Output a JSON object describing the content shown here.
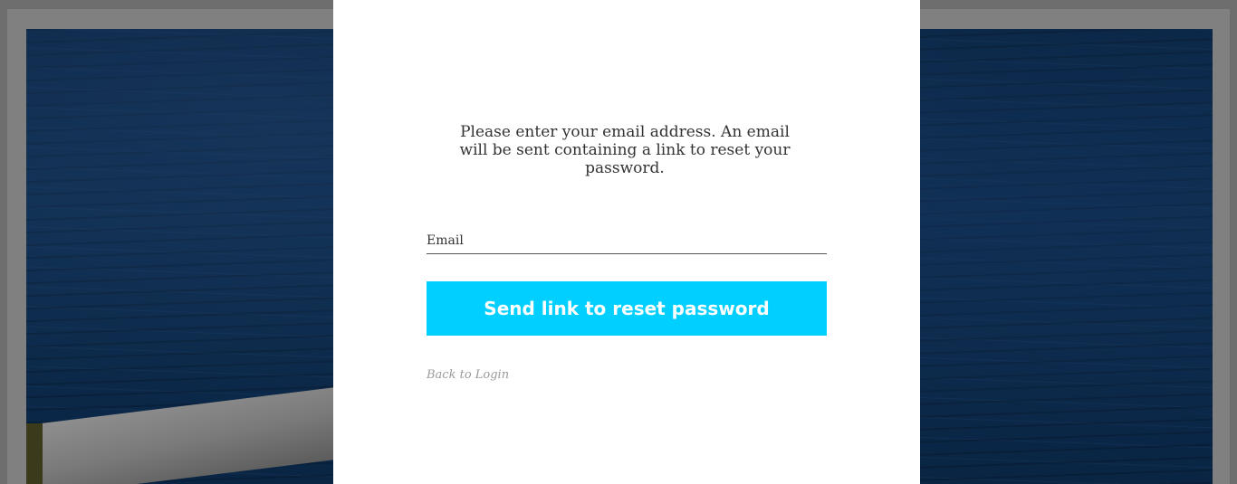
{
  "reset_form": {
    "instructions": "Please enter your email address. An email will be sent containing a link to reset your password.",
    "email_placeholder": "Email",
    "email_value": "",
    "submit_label": "Send link to reset password",
    "back_link_label": "Back to Login"
  },
  "colors": {
    "accent": "#00cfff",
    "panel_background": "#ffffff",
    "overlay": "#808080",
    "water": "#0c2a4b"
  }
}
